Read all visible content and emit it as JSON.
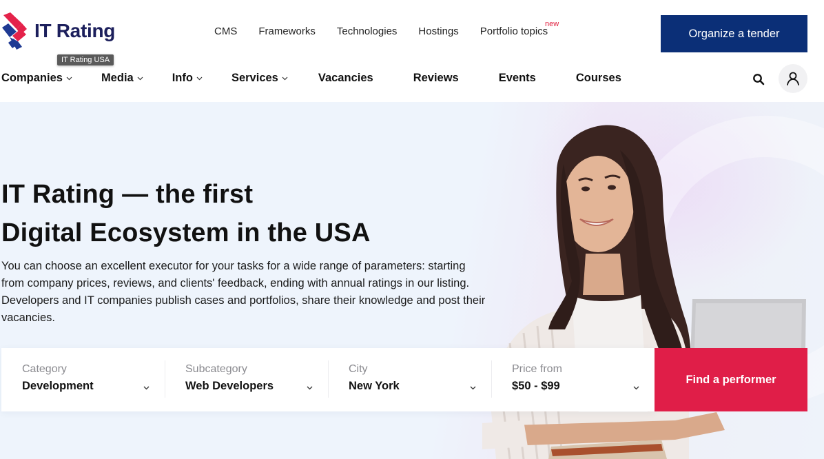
{
  "header": {
    "logo_text": "IT Rating",
    "logo_tooltip": "IT Rating USA",
    "top_links": [
      {
        "label": "CMS"
      },
      {
        "label": "Frameworks"
      },
      {
        "label": "Technologies"
      },
      {
        "label": "Hostings"
      },
      {
        "label": "Portfolio topics",
        "badge": "new"
      }
    ],
    "tender_button": "Organize a tender",
    "main_nav": [
      {
        "label": "Companies",
        "dropdown": true
      },
      {
        "label": "Media",
        "dropdown": true
      },
      {
        "label": "Info",
        "dropdown": true
      },
      {
        "label": "Services",
        "dropdown": true
      },
      {
        "label": "Vacancies",
        "dropdown": false
      },
      {
        "label": "Reviews",
        "dropdown": false
      },
      {
        "label": "Events",
        "dropdown": false
      },
      {
        "label": "Courses",
        "dropdown": false
      }
    ],
    "icons": {
      "search": "search-icon",
      "user": "user-icon"
    }
  },
  "hero": {
    "title_line1": "IT Rating — the first",
    "title_line2": "Digital Ecosystem in the USA",
    "description": "You can choose an excellent executor for your tasks for a wide range of parameters: starting from company prices, reviews, and clients' feedback, ending with annual ratings in our listing. Developers and IT companies publish cases and portfolios, share their knowledge and post their vacancies."
  },
  "search": {
    "fields": [
      {
        "label": "Category",
        "value": "Development"
      },
      {
        "label": "Subcategory",
        "value": "Web Developers"
      },
      {
        "label": "City",
        "value": "New York"
      },
      {
        "label": "Price from",
        "value": "$50 - $99"
      }
    ],
    "submit_label": "Find a performer"
  },
  "colors": {
    "brand_navy": "#1c1f5c",
    "tender_button": "#0b2f77",
    "accent_red": "#e01e48",
    "badge_new": "#e0203f",
    "hero_bg": "#eef4fc"
  }
}
